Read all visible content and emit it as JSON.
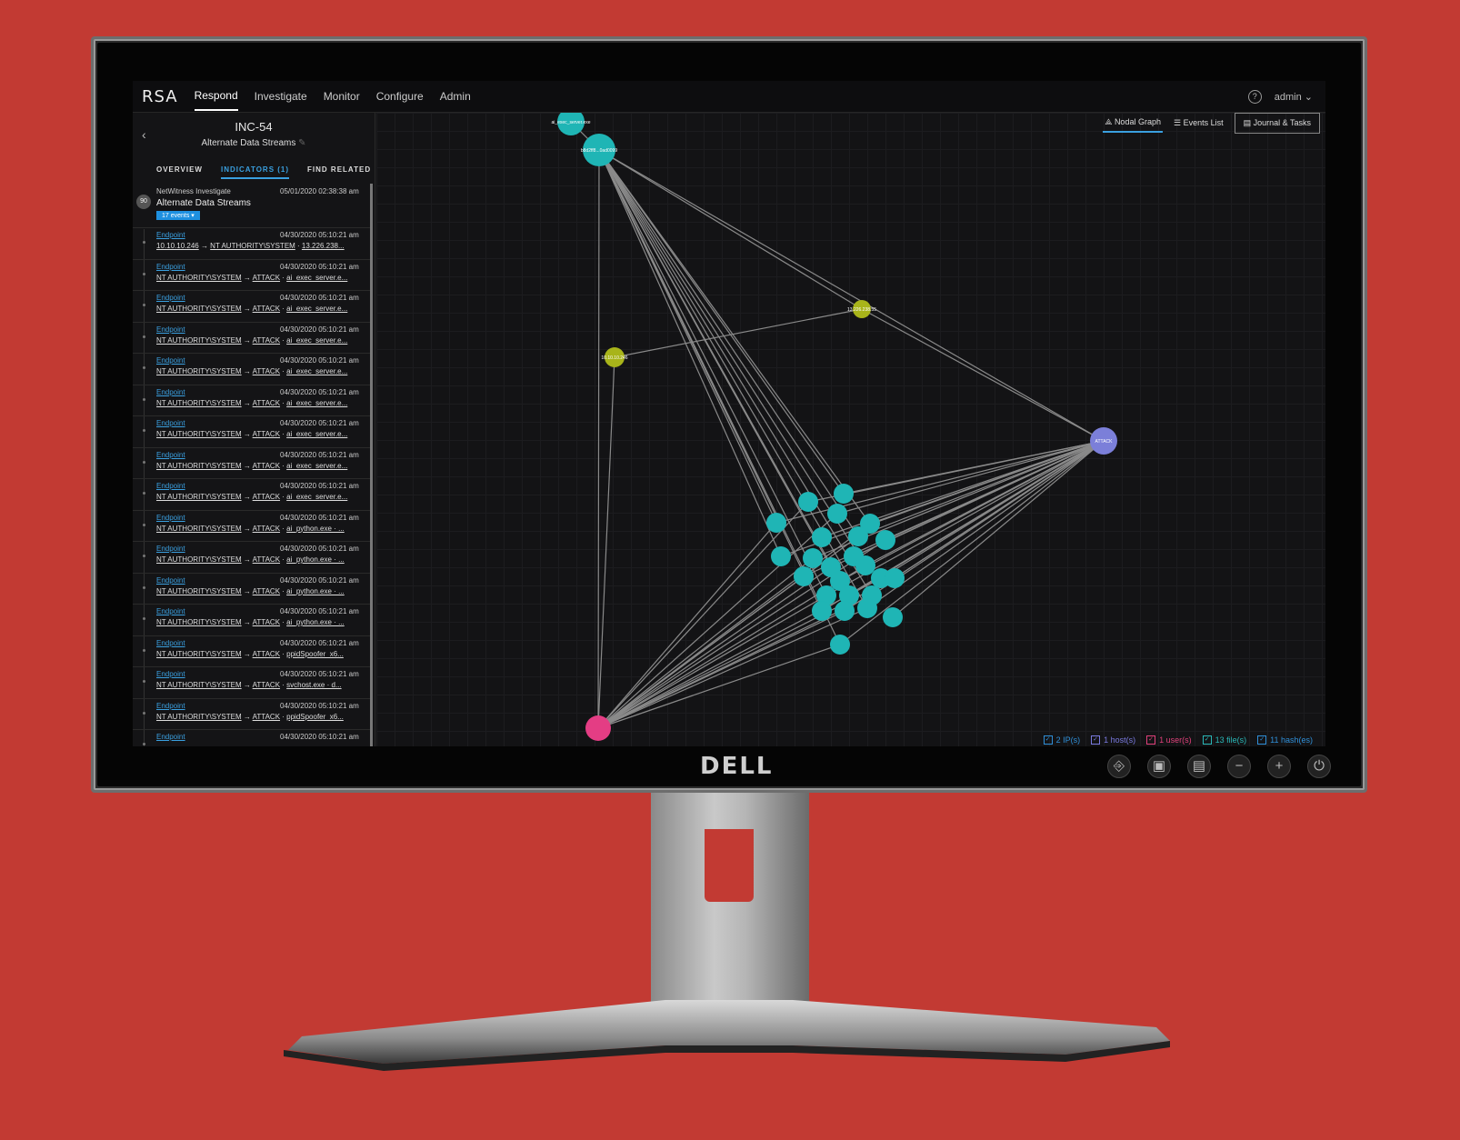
{
  "nav": {
    "logo": "RSA",
    "items": [
      "Respond",
      "Investigate",
      "Monitor",
      "Configure",
      "Admin"
    ],
    "active": "Respond",
    "user": "admin"
  },
  "incident": {
    "id": "INC-54",
    "name": "Alternate Data Streams"
  },
  "tabs": [
    "OVERVIEW",
    "INDICATORS (1)",
    "FIND RELATED"
  ],
  "indicator": {
    "score": "90",
    "source": "NetWitness Investigate",
    "timestamp": "05/01/2020 02:38:38 am",
    "name": "Alternate Data Streams",
    "events_button": "17 events"
  },
  "events": [
    {
      "source": "Endpoint",
      "time": "04/30/2020 05:10:21 am",
      "a": "10.10.10.246",
      "b": "NT AUTHORITY\\SYSTEM",
      "c": "13.226.238..."
    },
    {
      "source": "Endpoint",
      "time": "04/30/2020 05:10:21 am",
      "a": "NT AUTHORITY\\SYSTEM",
      "b": "ATTACK",
      "c": "ai_exec_server.e..."
    },
    {
      "source": "Endpoint",
      "time": "04/30/2020 05:10:21 am",
      "a": "NT AUTHORITY\\SYSTEM",
      "b": "ATTACK",
      "c": "ai_exec_server.e..."
    },
    {
      "source": "Endpoint",
      "time": "04/30/2020 05:10:21 am",
      "a": "NT AUTHORITY\\SYSTEM",
      "b": "ATTACK",
      "c": "ai_exec_server.e..."
    },
    {
      "source": "Endpoint",
      "time": "04/30/2020 05:10:21 am",
      "a": "NT AUTHORITY\\SYSTEM",
      "b": "ATTACK",
      "c": "ai_exec_server.e..."
    },
    {
      "source": "Endpoint",
      "time": "04/30/2020 05:10:21 am",
      "a": "NT AUTHORITY\\SYSTEM",
      "b": "ATTACK",
      "c": "ai_exec_server.e..."
    },
    {
      "source": "Endpoint",
      "time": "04/30/2020 05:10:21 am",
      "a": "NT AUTHORITY\\SYSTEM",
      "b": "ATTACK",
      "c": "ai_exec_server.e..."
    },
    {
      "source": "Endpoint",
      "time": "04/30/2020 05:10:21 am",
      "a": "NT AUTHORITY\\SYSTEM",
      "b": "ATTACK",
      "c": "ai_exec_server.e..."
    },
    {
      "source": "Endpoint",
      "time": "04/30/2020 05:10:21 am",
      "a": "NT AUTHORITY\\SYSTEM",
      "b": "ATTACK",
      "c": "ai_exec_server.e..."
    },
    {
      "source": "Endpoint",
      "time": "04/30/2020 05:10:21 am",
      "a": "NT AUTHORITY\\SYSTEM",
      "b": "ATTACK",
      "c": "ai_python.exe · ..."
    },
    {
      "source": "Endpoint",
      "time": "04/30/2020 05:10:21 am",
      "a": "NT AUTHORITY\\SYSTEM",
      "b": "ATTACK",
      "c": "ai_python.exe · ..."
    },
    {
      "source": "Endpoint",
      "time": "04/30/2020 05:10:21 am",
      "a": "NT AUTHORITY\\SYSTEM",
      "b": "ATTACK",
      "c": "ai_python.exe · ..."
    },
    {
      "source": "Endpoint",
      "time": "04/30/2020 05:10:21 am",
      "a": "NT AUTHORITY\\SYSTEM",
      "b": "ATTACK",
      "c": "ai_python.exe · ..."
    },
    {
      "source": "Endpoint",
      "time": "04/30/2020 05:10:21 am",
      "a": "NT AUTHORITY\\SYSTEM",
      "b": "ATTACK",
      "c": "ppidSpoofer_x6..."
    },
    {
      "source": "Endpoint",
      "time": "04/30/2020 05:10:21 am",
      "a": "NT AUTHORITY\\SYSTEM",
      "b": "ATTACK",
      "c": "svchost.exe · d..."
    },
    {
      "source": "Endpoint",
      "time": "04/30/2020 05:10:21 am",
      "a": "NT AUTHORITY\\SYSTEM",
      "b": "ATTACK",
      "c": "ppidSpoofer_x6..."
    },
    {
      "source": "Endpoint",
      "time": "04/30/2020 05:10:21 am",
      "a": "",
      "b": "",
      "c": ""
    }
  ],
  "graph_tools": {
    "nodal": "Nodal Graph",
    "events": "Events List",
    "journal": "Journal & Tasks"
  },
  "graph_nodes": {
    "attack": "ATTACK",
    "ip1": "13.226.238.55",
    "ip2": "10.10.10.246",
    "top1": "ai_exec_server.exe",
    "top2": "b8d2ff8...0ad0099"
  },
  "legend": [
    {
      "label": "2 IP(s)",
      "color": "#2f8fd8"
    },
    {
      "label": "1 host(s)",
      "color": "#7a7ae0"
    },
    {
      "label": "1 user(s)",
      "color": "#e0407a"
    },
    {
      "label": "13 file(s)",
      "color": "#2ab8b8"
    },
    {
      "label": "11 hash(es)",
      "color": "#2f8fd8"
    }
  ],
  "colors": {
    "file": "#1fb5b5",
    "ip": "#a8b41a",
    "host": "#7b7fd9",
    "user": "#e43d84",
    "accent": "#3aa0e0"
  },
  "monitor": {
    "brand": "DELL"
  }
}
